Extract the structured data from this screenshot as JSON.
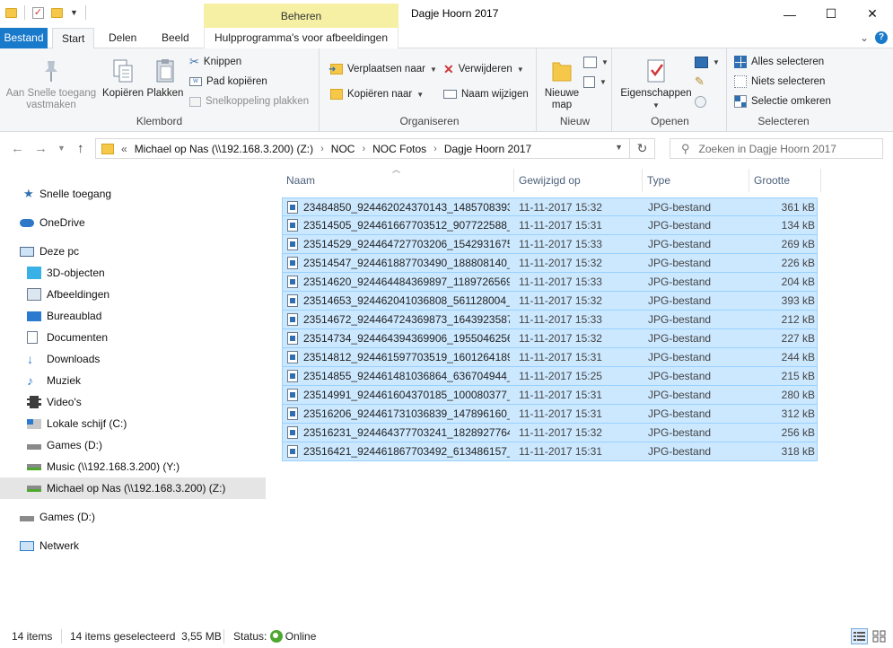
{
  "window": {
    "title": "Dagje Hoorn 2017",
    "contextual_tab_group": "Beheren",
    "minimize": "—",
    "maximize": "☐",
    "close": "✕"
  },
  "tabs": {
    "file": "Bestand",
    "start": "Start",
    "share": "Delen",
    "view": "Beeld",
    "picture_tools": "Hulpprogramma's voor afbeeldingen",
    "expand": "⌄",
    "help": "?"
  },
  "ribbon": {
    "klembord": {
      "label": "Klembord",
      "pin_line1": "Aan Snelle toegang",
      "pin_line2": "vastmaken",
      "copy": "Kopiëren",
      "paste": "Plakken",
      "cut": "Knippen",
      "copy_path": "Pad kopiëren",
      "paste_shortcut": "Snelkoppeling plakken"
    },
    "organiseren": {
      "label": "Organiseren",
      "move_to": "Verplaatsen naar",
      "copy_to": "Kopiëren naar",
      "delete": "Verwijderen",
      "rename": "Naam wijzigen"
    },
    "nieuw": {
      "label": "Nieuw",
      "new_folder_line1": "Nieuwe",
      "new_folder_line2": "map"
    },
    "openen": {
      "label": "Openen",
      "properties": "Eigenschappen"
    },
    "selecteren": {
      "label": "Selecteren",
      "select_all": "Alles selecteren",
      "select_none": "Niets selecteren",
      "invert": "Selectie omkeren"
    }
  },
  "address": {
    "overflow": "«",
    "crumbs": [
      "Michael op Nas (\\\\192.168.3.200) (Z:)",
      "NOC",
      "NOC Fotos",
      "Dagje Hoorn 2017"
    ],
    "separator": "›",
    "search_placeholder": "Zoeken in Dagje Hoorn 2017"
  },
  "nav": {
    "items": [
      {
        "label": "Snelle toegang"
      },
      {
        "label": "OneDrive"
      },
      {
        "label": "Deze pc"
      },
      {
        "label": "3D-objecten"
      },
      {
        "label": "Afbeeldingen"
      },
      {
        "label": "Bureaublad"
      },
      {
        "label": "Documenten"
      },
      {
        "label": "Downloads"
      },
      {
        "label": "Muziek"
      },
      {
        "label": "Video's"
      },
      {
        "label": "Lokale schijf (C:)"
      },
      {
        "label": "Games (D:)"
      },
      {
        "label": "Music (\\\\192.168.3.200) (Y:)"
      },
      {
        "label": "Michael op Nas (\\\\192.168.3.200) (Z:)"
      },
      {
        "label": "Games (D:)"
      },
      {
        "label": "Netwerk"
      }
    ]
  },
  "columns": {
    "name": "Naam",
    "modified": "Gewijzigd op",
    "type": "Type",
    "size": "Grootte"
  },
  "files": [
    {
      "name": "23484850_924462024370143_1485708393_...",
      "date": "11-11-2017 15:32",
      "type": "JPG-bestand",
      "size": "361 kB"
    },
    {
      "name": "23514505_924461667703512_907722588_o....",
      "date": "11-11-2017 15:31",
      "type": "JPG-bestand",
      "size": "134 kB"
    },
    {
      "name": "23514529_924464727703206_1542931675_...",
      "date": "11-11-2017 15:33",
      "type": "JPG-bestand",
      "size": "269 kB"
    },
    {
      "name": "23514547_924461887703490_188808140_o....",
      "date": "11-11-2017 15:32",
      "type": "JPG-bestand",
      "size": "226 kB"
    },
    {
      "name": "23514620_924464484369897_1189726569_...",
      "date": "11-11-2017 15:33",
      "type": "JPG-bestand",
      "size": "204 kB"
    },
    {
      "name": "23514653_924462041036808_561128004_o....",
      "date": "11-11-2017 15:32",
      "type": "JPG-bestand",
      "size": "393 kB"
    },
    {
      "name": "23514672_924464724369873_1643923587_...",
      "date": "11-11-2017 15:33",
      "type": "JPG-bestand",
      "size": "212 kB"
    },
    {
      "name": "23514734_924464394369906_1955046256_...",
      "date": "11-11-2017 15:32",
      "type": "JPG-bestand",
      "size": "227 kB"
    },
    {
      "name": "23514812_924461597703519_1601264189_...",
      "date": "11-11-2017 15:31",
      "type": "JPG-bestand",
      "size": "244 kB"
    },
    {
      "name": "23514855_924461481036864_636704944_o....",
      "date": "11-11-2017 15:25",
      "type": "JPG-bestand",
      "size": "215 kB"
    },
    {
      "name": "23514991_924461604370185_100080377_o....",
      "date": "11-11-2017 15:31",
      "type": "JPG-bestand",
      "size": "280 kB"
    },
    {
      "name": "23516206_924461731036839_147896160_o....",
      "date": "11-11-2017 15:31",
      "type": "JPG-bestand",
      "size": "312 kB"
    },
    {
      "name": "23516231_924464377703241_1828927764_...",
      "date": "11-11-2017 15:32",
      "type": "JPG-bestand",
      "size": "256 kB"
    },
    {
      "name": "23516421_924461867703492_613486157_o....",
      "date": "11-11-2017 15:31",
      "type": "JPG-bestand",
      "size": "318 kB"
    }
  ],
  "status": {
    "count": "14 items",
    "selected": "14 items geselecteerd  3,55 MB",
    "status_label": "Status:",
    "online": "Online"
  },
  "colors": {
    "accent": "#1979ca",
    "selection_fill": "#cce8ff",
    "selection_border": "#99d1ff",
    "contextual_tab": "#f5f0a3"
  }
}
